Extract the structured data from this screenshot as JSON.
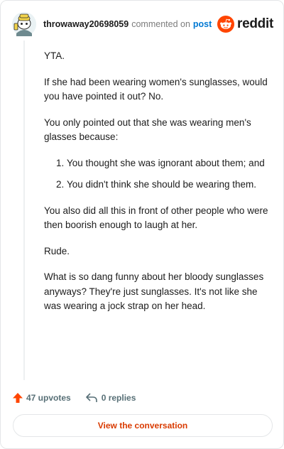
{
  "comment": {
    "username": "throwaway20698059",
    "action_text": "commented on",
    "post_link": "post",
    "brand": "reddit",
    "avatar_icon": "snoo-avatar-icon",
    "brand_color": "#ff4500",
    "paragraphs_top": [
      "YTA.",
      "If she had been wearing women's sunglasses, would you have pointed it out? No.",
      "You only pointed out that she was wearing men's glasses because:"
    ],
    "list_items": [
      "You thought she was ignorant about them; and",
      "You didn't think she should be wearing them."
    ],
    "paragraphs_bottom": [
      "You also did all this in front of other people who were then boorish enough to laugh at her.",
      "Rude.",
      "What is so dang funny about her bloody sunglasses anyways? They're just sunglasses. It's not like she was wearing a jock strap on her head."
    ]
  },
  "footer": {
    "upvotes": "47 upvotes",
    "replies": "0 replies",
    "upvote_icon": "upvote-arrow-icon",
    "reply_icon": "reply-icon",
    "upvote_color": "#ff4500",
    "view_conversation": "View the conversation"
  }
}
